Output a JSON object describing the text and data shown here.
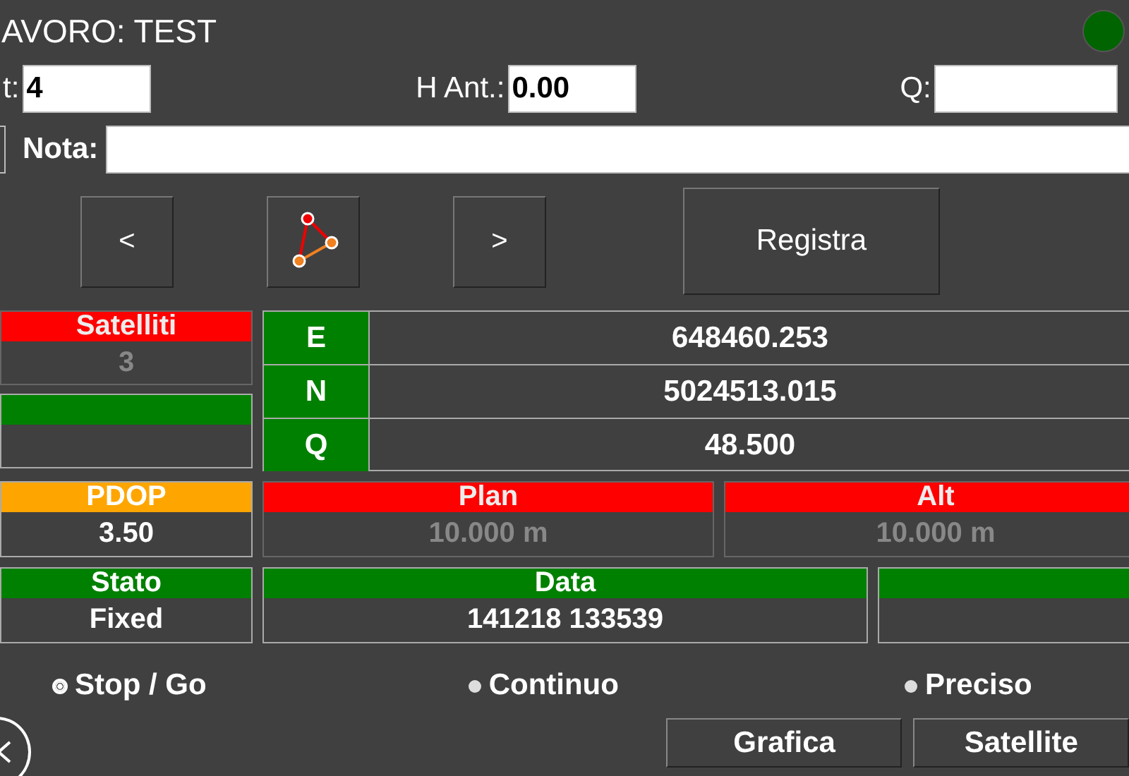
{
  "job_title": "AVORO: TEST",
  "connection": {
    "color": "#006400"
  },
  "fields": [
    {
      "label": "t:",
      "value": "4"
    },
    {
      "label": "H Ant.:",
      "value": "0.00"
    },
    {
      "label": "Q:"
    }
  ],
  "note": {
    "label": "Nota:"
  },
  "nav_buttons": [
    {
      "kind": "text",
      "label": "<"
    },
    {
      "kind": "icon"
    },
    {
      "kind": "text",
      "label": ">"
    }
  ],
  "register_button": "Registra",
  "left_cells": [
    {
      "label": "Satelliti",
      "value": "3",
      "color": "#ff0000",
      "dim": true
    },
    {
      "color": "#008000",
      "dim": false
    }
  ],
  "coordinates": [
    {
      "axis": "E",
      "value": "648460.253"
    },
    {
      "axis": "N",
      "value": "5024513.015"
    },
    {
      "axis": "Q",
      "value": "48.500"
    }
  ],
  "info_rows": [
    [
      {
        "label": "PDOP",
        "value": "3.50",
        "color": "#ffa500",
        "dim": false
      },
      {
        "label": "Plan",
        "value": "10.000 m",
        "color": "#ff0000",
        "dim": true
      },
      {
        "label": "Alt",
        "value": "10.000 m",
        "color": "#ff0000",
        "dim": true
      }
    ],
    [
      {
        "label": "Stato",
        "value": "Fixed",
        "color": "#008000",
        "dim": false
      },
      {
        "label": "Data",
        "value": "141218 133539",
        "color": "#008000",
        "dim": false
      },
      {
        "color": "#008000",
        "dim": false
      }
    ]
  ],
  "modes": [
    {
      "label": "Stop / Go",
      "selected": true
    },
    {
      "label": "Continuo",
      "selected": false
    },
    {
      "label": "Preciso",
      "selected": false
    }
  ],
  "bottom_buttons": [
    "Grafica",
    "Satellite"
  ]
}
